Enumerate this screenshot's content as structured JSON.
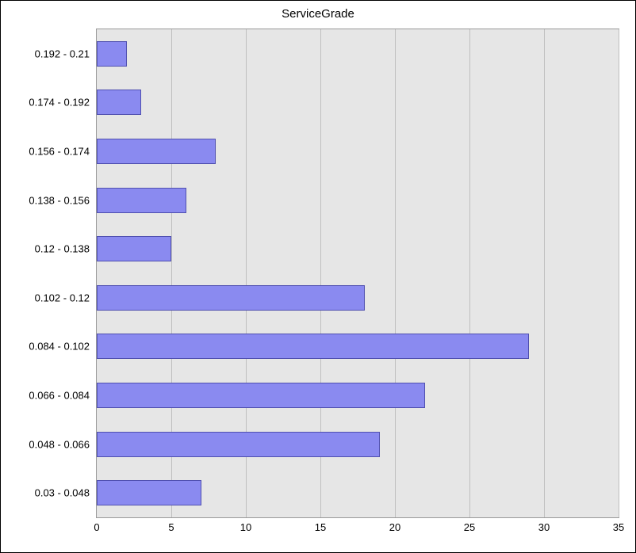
{
  "chart_data": {
    "type": "bar",
    "title": "ServiceGrade",
    "categories": [
      "0.192 - 0.21",
      "0.174 - 0.192",
      "0.156 - 0.174",
      "0.138 - 0.156",
      "0.12 - 0.138",
      "0.102 - 0.12",
      "0.084 - 0.102",
      "0.066 - 0.084",
      "0.048 - 0.066",
      "0.03 - 0.048"
    ],
    "values": [
      2,
      3,
      8,
      6,
      5,
      18,
      29,
      22,
      19,
      7
    ],
    "xlabel": "",
    "ylabel": "",
    "xticks": [
      0,
      5,
      10,
      15,
      20,
      25,
      30,
      35
    ],
    "xlim": [
      0,
      35
    ]
  }
}
